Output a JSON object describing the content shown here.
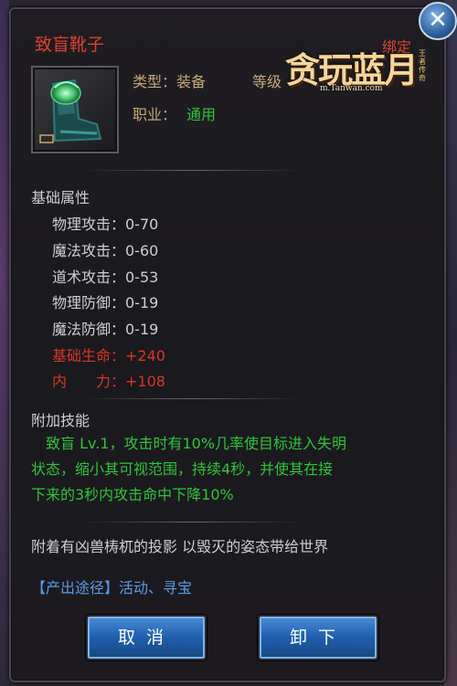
{
  "item": {
    "name": "致盲靴子",
    "bind": "绑定",
    "type_label": "类型：装备",
    "level_label": "等级",
    "class_label": "职业：",
    "class_value": "通用"
  },
  "logo": {
    "title": "贪玩蓝月",
    "url": "m.Tanwan.com",
    "side": "王者传奇"
  },
  "base_stats": {
    "title": "基础属性",
    "rows": [
      {
        "label": "物理攻击：0-70"
      },
      {
        "label": "魔法攻击：0-60"
      },
      {
        "label": "道术攻击：0-53"
      },
      {
        "label": "物理防御：0-19"
      },
      {
        "label": "魔法防御：0-19"
      },
      {
        "label": "基础生命：+240"
      },
      {
        "label": "内　　力：+108"
      }
    ]
  },
  "skills": {
    "title": "附加技能",
    "line1": "　致盲 Lv.1，攻击时有10%几率使目标进入失明",
    "line2": "状态，缩小其可视范围，持续4秒，并使其在接",
    "line3": "下来的3秒内攻击命中下降10%"
  },
  "flavor": "附着有凶兽梼杌的投影  以毁灭的姿态带给世界",
  "source": "【产出途径】活动、寻宝",
  "buttons": {
    "cancel": "取消",
    "unequip": "卸下",
    "close": "✕"
  },
  "colors": {
    "name_red": "#e0412f",
    "skill_green": "#2ec43a",
    "source_blue": "#5a9be8",
    "button_blue": "#1f5fae"
  }
}
